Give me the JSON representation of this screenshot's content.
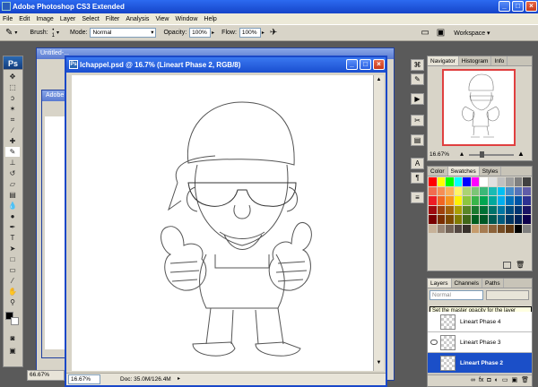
{
  "window": {
    "title": "Adobe Photoshop CS3 Extended"
  },
  "menu": [
    "File",
    "Edit",
    "Image",
    "Layer",
    "Select",
    "Filter",
    "Analysis",
    "View",
    "Window",
    "Help"
  ],
  "options": {
    "brush_label": "Brush:",
    "brush_size": "1",
    "mode_label": "Mode:",
    "mode_value": "Normal",
    "opacity_label": "Opacity:",
    "opacity_value": "100%",
    "flow_label": "Flow:",
    "flow_value": "100%",
    "workspace_label": "Workspace ▾"
  },
  "background_docs": {
    "doc1_title": "Untitled-...",
    "doc2_title": "Adobe Photoshop",
    "doc1_zoom": "66.67%"
  },
  "document": {
    "title": "lchappel.psd @ 16.7% (Lineart Phase 2, RGB/8)",
    "zoom": "16.67%",
    "doc_size": "Doc: 35.0M/126.4M"
  },
  "navigator": {
    "tabs": [
      "Navigator",
      "Histogram",
      "Info"
    ],
    "zoom": "16.67%"
  },
  "swatches": {
    "tabs": [
      "Color",
      "Swatches",
      "Styles"
    ],
    "colors": [
      "#ff0000",
      "#ffff00",
      "#00ff00",
      "#00ffff",
      "#0000ff",
      "#ff00ff",
      "#ffffff",
      "#e0e0e0",
      "#c0c0c0",
      "#a0a0a0",
      "#808080",
      "#404040",
      "#f26c4f",
      "#f68e55",
      "#fbaf5c",
      "#fff467",
      "#acd372",
      "#7cc576",
      "#3bb878",
      "#1abbb4",
      "#00bff3",
      "#438cca",
      "#5574b9",
      "#605ca8",
      "#ed1c24",
      "#f26522",
      "#f7941d",
      "#fff200",
      "#8dc63f",
      "#39b54a",
      "#00a651",
      "#00a99d",
      "#00aeef",
      "#0072bc",
      "#0054a6",
      "#2e3192",
      "#9e0b0f",
      "#a0410d",
      "#a36209",
      "#aba000",
      "#598527",
      "#1a7b30",
      "#007236",
      "#00746b",
      "#0076a3",
      "#004b80",
      "#003471",
      "#1b1464",
      "#790000",
      "#7b2e00",
      "#7d4900",
      "#827b00",
      "#406618",
      "#005e20",
      "#005826",
      "#005952",
      "#005b7f",
      "#003663",
      "#002157",
      "#0d004c",
      "#c7b299",
      "#998675",
      "#736357",
      "#534741",
      "#37302a",
      "#c69c6d",
      "#a67c52",
      "#8c6239",
      "#754c24",
      "#603913",
      "#000000",
      "#7f7f7f"
    ]
  },
  "layers": {
    "tabs": [
      "Layers",
      "Channels",
      "Paths"
    ],
    "blend_mode": "Normal",
    "tooltip": "Set the master opacity for the layer",
    "items": [
      "Lineart Phase 4",
      "Lineart Phase 3",
      "Lineart Phase 2"
    ]
  },
  "colors": {
    "titlebar": "#1a4ed0",
    "selected_layer": "#1b4fc8",
    "navigator_box": "#e04040"
  }
}
